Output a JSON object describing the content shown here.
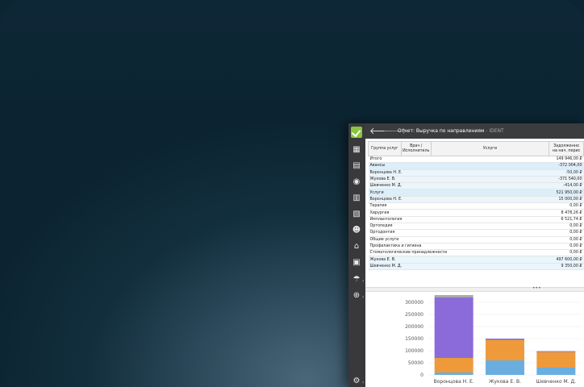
{
  "window": {
    "back_icon": "arrow-left-icon",
    "forward_icon": "arrow-right-icon",
    "title": "Отчет: Выручка по направлениям",
    "title_suffix": " - IDENT"
  },
  "sidebar": {
    "items": [
      {
        "icon": "checkmark-logo-icon"
      },
      {
        "icon": "schedule-icon"
      },
      {
        "icon": "patient-card-icon"
      },
      {
        "icon": "finance-icon"
      },
      {
        "icon": "cash-register-icon"
      },
      {
        "icon": "reports-icon"
      },
      {
        "icon": "staff-icon"
      },
      {
        "icon": "tooth-icon"
      },
      {
        "icon": "documents-icon"
      },
      {
        "icon": "insurance-icon"
      },
      {
        "icon": "search-money-icon"
      },
      {
        "icon": "settings-gear-icon"
      }
    ]
  },
  "table": {
    "headers": [
      "Группа услуг",
      "Врач /\nИсполнитель",
      "Услуги",
      "Задолженно\nна нач. перис"
    ],
    "rows": [
      {
        "label": "Итого",
        "value": "149 946,00 ₽",
        "style": ""
      },
      {
        "label": "Авансы",
        "value": "-372 004,00",
        "style": "hl"
      },
      {
        "label": "Воронцова Н. Е.",
        "value": "-50,00 ₽",
        "style": "hl2"
      },
      {
        "label": "Жукова Е. В.",
        "value": "-371 540,00",
        "style": "hl2"
      },
      {
        "label": "Шевченко М. Д.",
        "value": "-414,00 ₽",
        "style": "hl2"
      },
      {
        "label": "Услуги",
        "value": "521 950,00 ₽",
        "style": "hl"
      },
      {
        "label": "Воронцова Н. Е.",
        "value": "15 000,00 ₽",
        "style": "hl2"
      },
      {
        "label": "Терапия",
        "value": "0,00 ₽",
        "style": ""
      },
      {
        "label": "Хирургия",
        "value": "8 478,26 ₽",
        "style": ""
      },
      {
        "label": "Имплантология",
        "value": "6 521,74 ₽",
        "style": ""
      },
      {
        "label": "Ортопедия",
        "value": "0,00 ₽",
        "style": ""
      },
      {
        "label": "Ортодонтия",
        "value": "0,00 ₽",
        "style": ""
      },
      {
        "label": "Общие услуги",
        "value": "0,00 ₽",
        "style": ""
      },
      {
        "label": "Профилактика и гигиена",
        "value": "0,00 ₽",
        "style": ""
      },
      {
        "label": "Стоматологические принадлежности",
        "value": "0,00 ₽",
        "style": ""
      },
      {
        "label": "Жукова Е. В.",
        "value": "497 600,00 ₽",
        "style": "hl2"
      },
      {
        "label": "Шевченко М. Д.",
        "value": "9 350,00 ₽",
        "style": "hl2"
      }
    ]
  },
  "splitter": {
    "label": "•••"
  },
  "chart_data": {
    "type": "bar",
    "stacked": true,
    "categories": [
      "Воронцова Н. Е.",
      "Жукова Е. В.",
      "Шевченко М. Д."
    ],
    "series": [
      {
        "values": [
          10000,
          60000,
          30000
        ],
        "color": "#6aaee0"
      },
      {
        "values": [
          60000,
          85000,
          65000
        ],
        "color": "#ee9a3a"
      },
      {
        "values": [
          250000,
          5000,
          3000
        ],
        "color": "#8b6bd9"
      },
      {
        "values": [
          10000,
          0,
          0
        ],
        "color": "#a9a9a9"
      }
    ],
    "ylim": [
      0,
      320000
    ],
    "yticks": [
      "0",
      "50000",
      "100000",
      "150000",
      "200000",
      "250000",
      "300000"
    ]
  }
}
